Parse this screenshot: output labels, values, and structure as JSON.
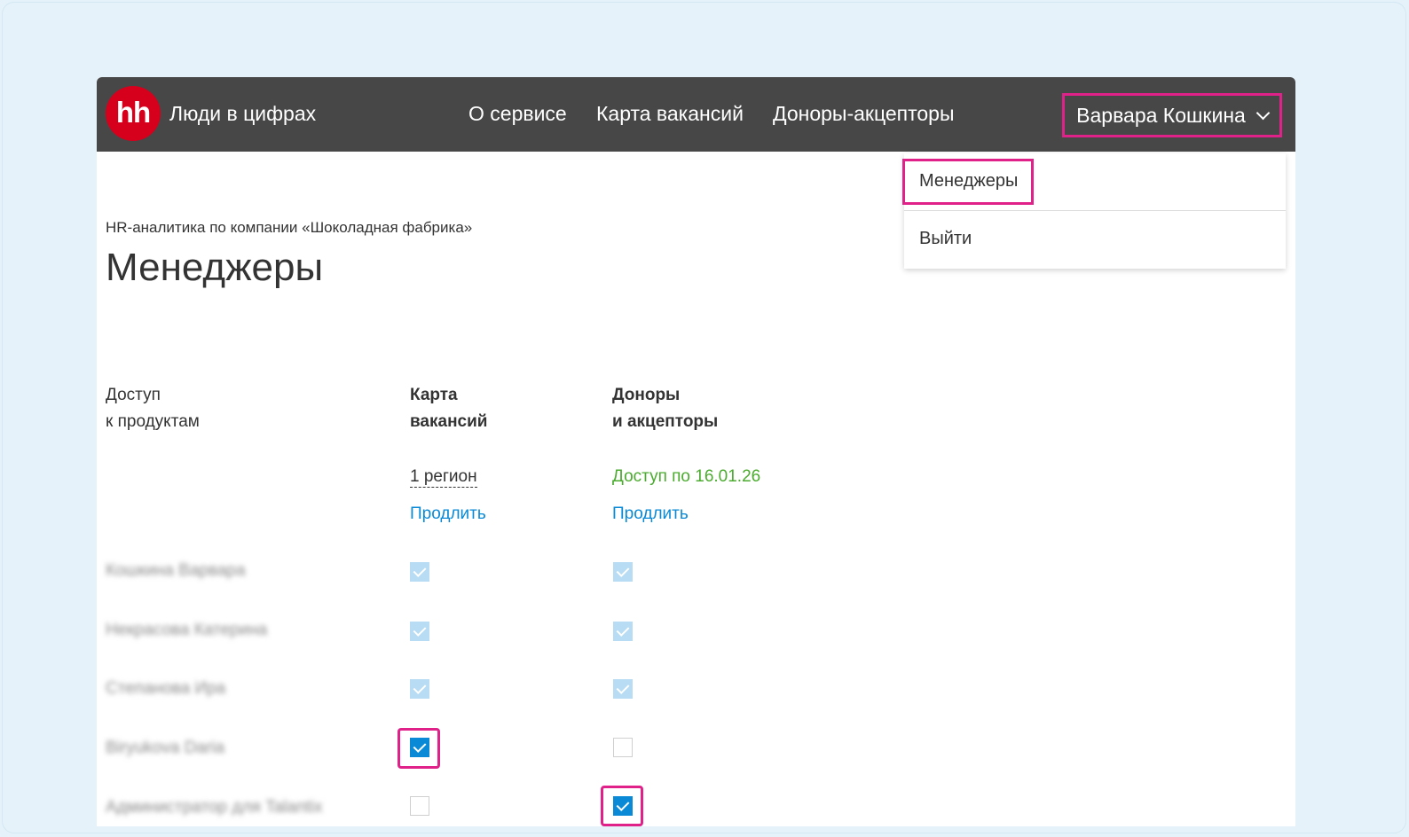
{
  "header": {
    "logo_text": "hh",
    "brand": "Люди в цифрах",
    "nav": [
      "О сервисе",
      "Карта вакансий",
      "Доноры-акцепторы"
    ],
    "user_name": "Варвара Кошкина"
  },
  "dropdown": {
    "items": [
      "Менеджеры",
      "Выйти"
    ]
  },
  "page": {
    "breadcrumb": "HR-аналитика по компании «Шоколадная фабрика»",
    "title": "Менеджеры"
  },
  "access": {
    "label_line1": "Доступ",
    "label_line2": "к продуктам",
    "columns": [
      {
        "title_line1": "Карта",
        "title_line2": "вакансий",
        "status": "1 регион",
        "extend": "Продлить"
      },
      {
        "title_line1": "Доноры",
        "title_line2": "и акцепторы",
        "status": "Доступ по 16.01.26",
        "extend": "Продлить"
      }
    ]
  },
  "managers": [
    {
      "name": "Кошкина Варвара",
      "vacancies_map": "checked-disabled",
      "donors": "checked-disabled"
    },
    {
      "name": "Некрасова Катерина",
      "vacancies_map": "checked-disabled",
      "donors": "checked-disabled"
    },
    {
      "name": "Степанова Ира",
      "vacancies_map": "checked-disabled",
      "donors": "checked-disabled"
    },
    {
      "name": "Biryukova Daria",
      "vacancies_map": "checked",
      "donors": "unchecked"
    },
    {
      "name": "Администратор для Talantix",
      "vacancies_map": "unchecked",
      "donors": "checked"
    }
  ],
  "colors": {
    "topbar": "#474747",
    "logo": "#d6001c",
    "highlight": "#e0218a",
    "link": "#0a8ad6",
    "access_ok": "#4aab2e",
    "checkbox_checked": "#0a8ad6",
    "checkbox_disabled": "#b7dcf3"
  }
}
